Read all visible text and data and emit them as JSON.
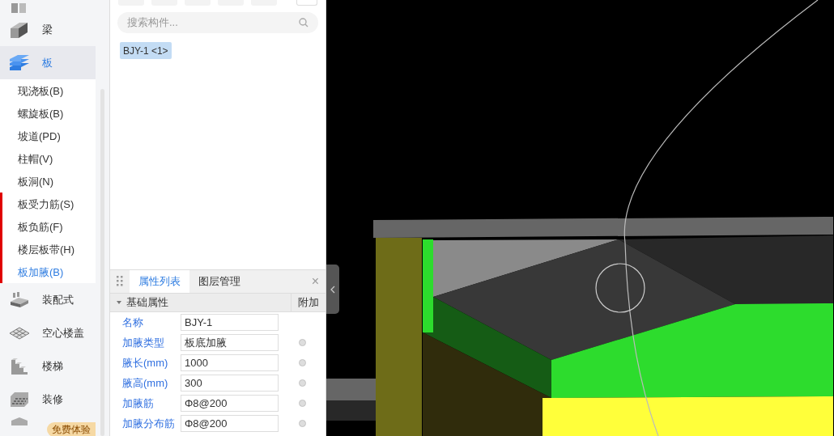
{
  "sidebar": {
    "categories": [
      {
        "label": "梁",
        "selected": false
      },
      {
        "label": "板",
        "selected": true,
        "children": [
          {
            "label": "现浇板(B)",
            "selected": false,
            "flagged": false
          },
          {
            "label": "螺旋板(B)",
            "selected": false,
            "flagged": false
          },
          {
            "label": "坡道(PD)",
            "selected": false,
            "flagged": false
          },
          {
            "label": "柱帽(V)",
            "selected": false,
            "flagged": false
          },
          {
            "label": "板洞(N)",
            "selected": false,
            "flagged": false
          },
          {
            "label": "板受力筋(S)",
            "selected": false,
            "flagged": true
          },
          {
            "label": "板负筋(F)",
            "selected": false,
            "flagged": true
          },
          {
            "label": "楼层板带(H)",
            "selected": false,
            "flagged": true
          },
          {
            "label": "板加腋(B)",
            "selected": true,
            "flagged": true
          }
        ]
      },
      {
        "label": "装配式",
        "selected": false
      },
      {
        "label": "空心楼盖",
        "selected": false
      },
      {
        "label": "楼梯",
        "selected": false
      },
      {
        "label": "装修",
        "selected": false
      }
    ],
    "badge": "免费体验"
  },
  "component_list": {
    "search": {
      "placeholder": "搜索构件..."
    },
    "items": [
      {
        "label": "BJY-1 <1>",
        "selected": true
      }
    ]
  },
  "properties": {
    "tabs": [
      {
        "label": "属性列表",
        "selected": true
      },
      {
        "label": "图层管理",
        "selected": false
      }
    ],
    "close": "×",
    "group": {
      "label": "基础属性",
      "expanded": true
    },
    "extra_column": "附加",
    "rows": [
      {
        "name": "名称",
        "value": "BJY-1",
        "has_extra": false
      },
      {
        "name": "加腋类型",
        "value": "板底加腋",
        "has_extra": true
      },
      {
        "name": "腋长(mm)",
        "value": "1000",
        "has_extra": true
      },
      {
        "name": "腋高(mm)",
        "value": "300",
        "has_extra": true
      },
      {
        "name": "加腋筋",
        "value": "Φ8@200",
        "has_extra": true
      },
      {
        "name": "加腋分布筋",
        "value": "Φ8@200",
        "has_extra": true
      }
    ]
  }
}
